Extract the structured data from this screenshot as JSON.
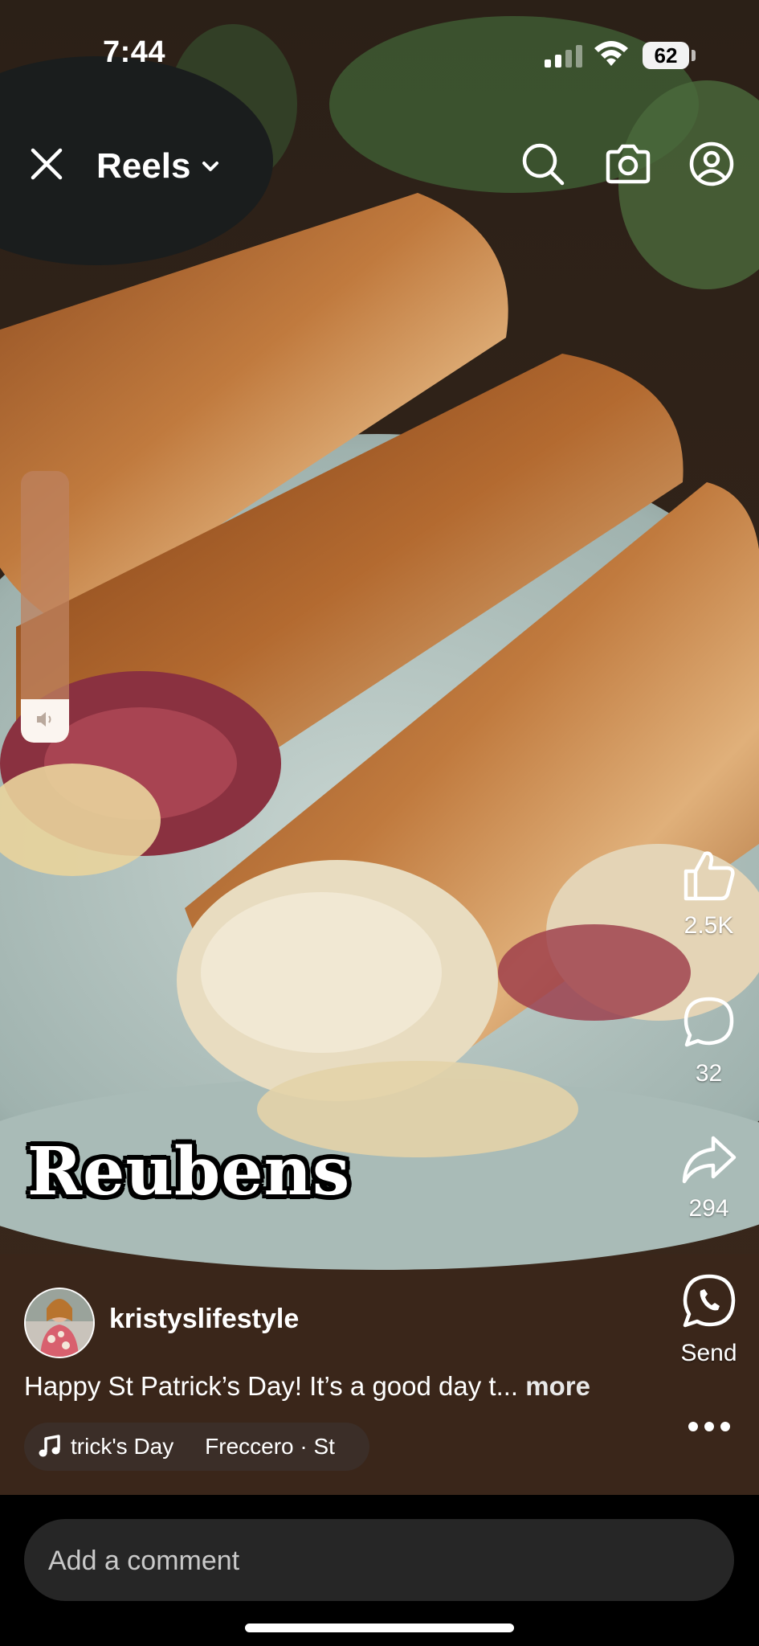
{
  "status_bar": {
    "time": "7:44",
    "battery": "62"
  },
  "header": {
    "title": "Reels"
  },
  "icons": {
    "close": "close-icon",
    "dropdown": "chevron-down-icon",
    "search": "search-icon",
    "camera": "camera-icon",
    "profile": "profile-icon",
    "like": "thumbs-up-icon",
    "comment": "comment-bubble-icon",
    "share": "share-arrow-icon",
    "whatsapp": "whatsapp-icon",
    "more": "more-horizontal-icon",
    "music": "music-note-icon",
    "speaker": "speaker-icon"
  },
  "volume": {
    "level": 0.16
  },
  "video": {
    "overlay_title": "Reubens"
  },
  "actions": {
    "likes": "2.5K",
    "comments": "32",
    "shares": "294",
    "send_label": "Send"
  },
  "creator": {
    "username": "kristyslifestyle",
    "caption": "Happy St Patrick’s Day! It’s a good day t...",
    "more_label": "more",
    "music": "trick's Day     Freccero · St"
  },
  "comment": {
    "placeholder": "Add a comment"
  },
  "colors": {
    "background": "#000000",
    "comment_field": "#262626",
    "text": "#ffffff"
  }
}
